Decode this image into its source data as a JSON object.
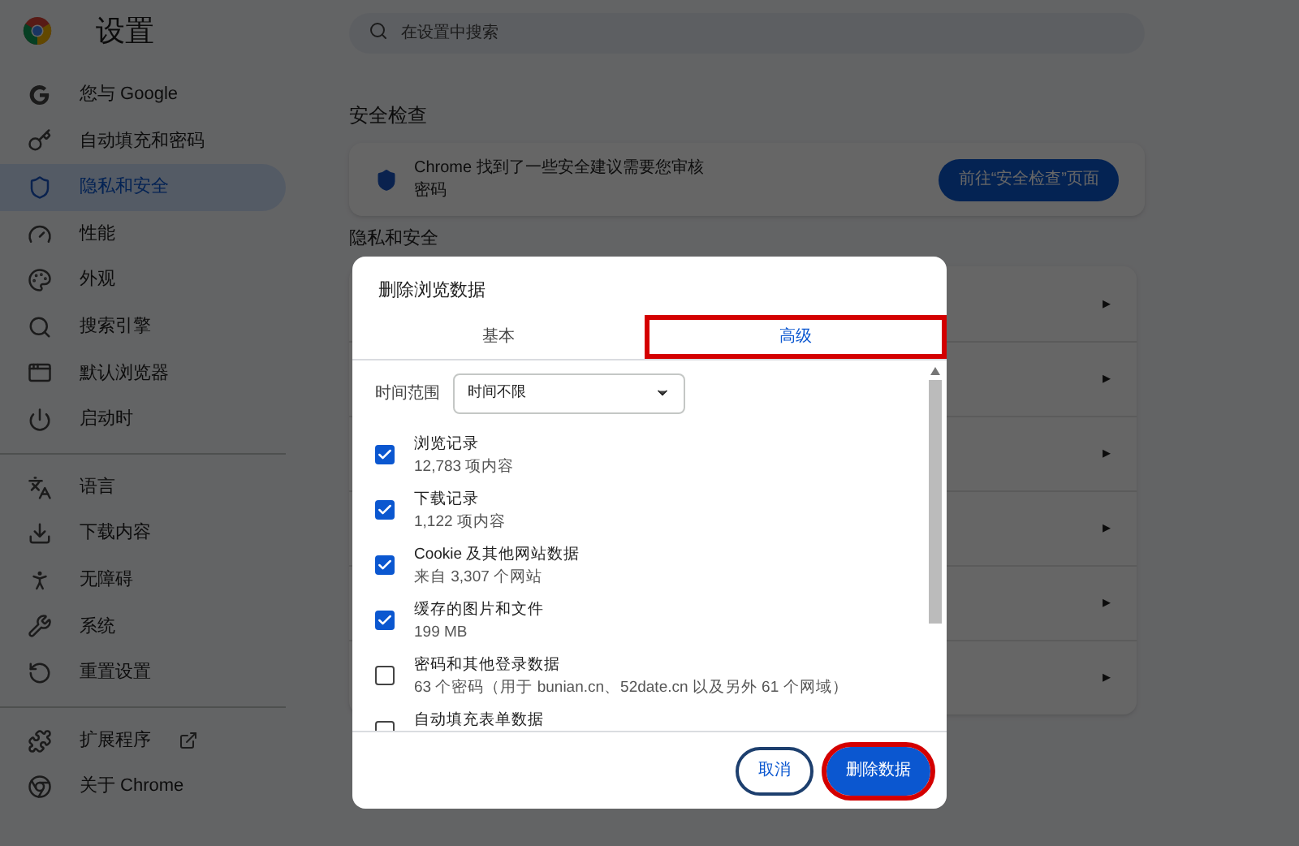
{
  "app": {
    "title": "设置"
  },
  "sidebar": {
    "groups": [
      {
        "items": [
          {
            "label": "您与 Google",
            "selected": false,
            "external": false
          },
          {
            "label": "自动填充和密码",
            "selected": false,
            "external": false
          },
          {
            "label": "隐私和安全",
            "selected": true,
            "external": false
          },
          {
            "label": "性能",
            "selected": false,
            "external": false
          },
          {
            "label": "外观",
            "selected": false,
            "external": false
          },
          {
            "label": "搜索引擎",
            "selected": false,
            "external": false
          },
          {
            "label": "默认浏览器",
            "selected": false,
            "external": false
          },
          {
            "label": "启动时",
            "selected": false,
            "external": false
          }
        ]
      },
      {
        "items": [
          {
            "label": "语言",
            "selected": false,
            "external": false
          },
          {
            "label": "下载内容",
            "selected": false,
            "external": false
          },
          {
            "label": "无障碍",
            "selected": false,
            "external": false
          },
          {
            "label": "系统",
            "selected": false,
            "external": false
          },
          {
            "label": "重置设置",
            "selected": false,
            "external": false
          }
        ]
      },
      {
        "items": [
          {
            "label": "扩展程序",
            "selected": false,
            "external": true
          },
          {
            "label": "关于 Chrome",
            "selected": false,
            "external": false
          }
        ]
      }
    ]
  },
  "search": {
    "placeholder": "在设置中搜索"
  },
  "safety_check": {
    "heading": "安全检查",
    "message": "Chrome 找到了一些安全建议需要您审核",
    "detail": "密码",
    "button": "前往“安全检查”页面"
  },
  "privacy_section": {
    "heading": "隐私和安全",
    "rows": [
      {
        "arrow": "▸"
      },
      {
        "arrow": "▸"
      },
      {
        "arrow": "▸"
      },
      {
        "arrow": "▸"
      },
      {
        "arrow": "▸"
      },
      {
        "arrow": "▸"
      }
    ]
  },
  "dialog": {
    "title": "删除浏览数据",
    "tabs": [
      {
        "label": "基本",
        "selected": false,
        "highlighted": false
      },
      {
        "label": "高级",
        "selected": true,
        "highlighted": true
      }
    ],
    "time_range": {
      "label": "时间范围",
      "value": "时间不限"
    },
    "items": [
      {
        "label": "浏览记录",
        "detail": "12,783 项内容",
        "checked": true
      },
      {
        "label": "下载记录",
        "detail": "1,122 项内容",
        "checked": true
      },
      {
        "label": "Cookie 及其他网站数据",
        "detail": "来自 3,307 个网站",
        "checked": true
      },
      {
        "label": "缓存的图片和文件",
        "detail": "199 MB",
        "checked": true
      },
      {
        "label": "密码和其他登录数据",
        "detail": "63 个密码（用于 bunian.cn、52date.cn 以及另外 61 个网域）",
        "checked": false
      },
      {
        "label": "自动填充表单数据",
        "checked": false
      }
    ],
    "buttons": [
      {
        "label": "取消",
        "kind": "secondary",
        "highlighted": false
      },
      {
        "label": "删除数据",
        "kind": "primary",
        "highlighted": true
      }
    ]
  }
}
